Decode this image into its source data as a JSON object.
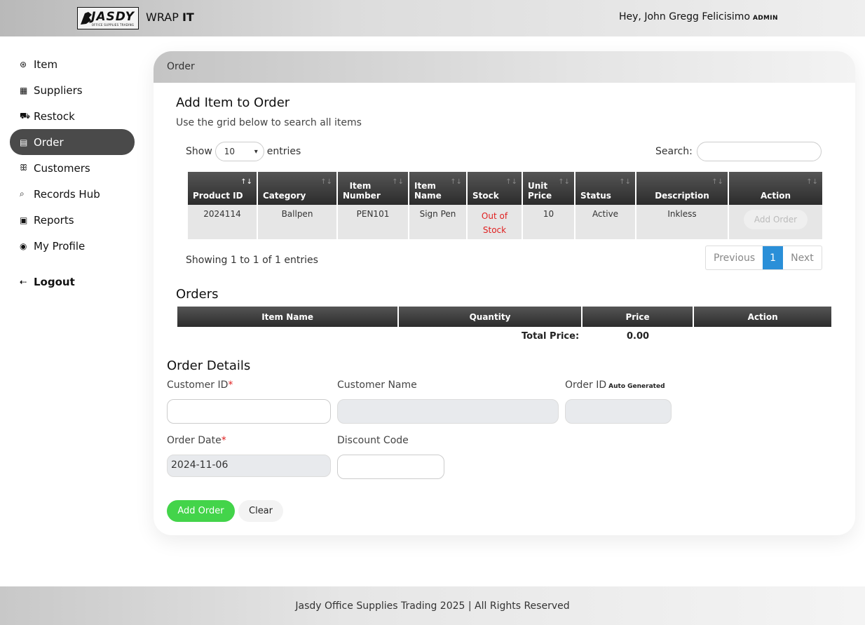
{
  "header": {
    "logo_text": "JASDY",
    "logo_subtext": "OFFICE SUPPLIES TRADING",
    "brand_prefix": "WRAP ",
    "brand_bold": "IT",
    "greeting": "Hey, John Gregg Felicisimo",
    "role": "ADMIN"
  },
  "sidebar": {
    "items": [
      {
        "label": "Item",
        "icon": "box-icon",
        "glyph": "⊛"
      },
      {
        "label": "Suppliers",
        "icon": "store-icon",
        "glyph": "▦"
      },
      {
        "label": "Restock",
        "icon": "cart-icon",
        "glyph": "⛟"
      },
      {
        "label": "Order",
        "icon": "receipt-icon",
        "glyph": "▤"
      },
      {
        "label": "Customers",
        "icon": "users-icon",
        "glyph": "ꕥ"
      },
      {
        "label": "Records Hub",
        "icon": "search-doc-icon",
        "glyph": "⌕"
      },
      {
        "label": "Reports",
        "icon": "clipboard-icon",
        "glyph": "▣"
      },
      {
        "label": "My Profile",
        "icon": "user-circle-icon",
        "glyph": "◉"
      }
    ],
    "logout": {
      "label": "Logout",
      "icon": "logout-icon",
      "glyph": "⇠"
    },
    "active_index": 3
  },
  "card": {
    "breadcrumb": "Order",
    "add_title": "Add Item to Order",
    "add_subtitle": "Use the grid below to search all items",
    "show_label": "Show",
    "entries_value": "10",
    "entries_label": "entries",
    "search_label": "Search:",
    "search_value": "",
    "columns": [
      "Product ID",
      "Category",
      "Item Number",
      "Item Name",
      "Stock",
      "Unit Price",
      "Status",
      "Description",
      "Action"
    ],
    "rows": [
      {
        "product_id": "2024114",
        "category": "Ballpen",
        "item_number": "PEN101",
        "item_name": "Sign Pen",
        "stock": "Out of Stock",
        "unit_price": "10",
        "status": "Active",
        "description": "Inkless",
        "action": "Add Order"
      }
    ],
    "showing": "Showing 1 to 1 of 1 entries",
    "pager": {
      "previous": "Previous",
      "current": "1",
      "next": "Next"
    },
    "orders_title": "Orders",
    "order_columns": [
      "Item Name",
      "Quantity",
      "Price",
      "Action"
    ],
    "total_label": "Total Price:",
    "total_value": "0.00"
  },
  "details": {
    "title": "Order Details",
    "customer_id_label": "Customer ID",
    "customer_id_value": "",
    "customer_name_label": "Customer Name",
    "customer_name_value": "",
    "order_id_label": "Order ID",
    "order_id_tag": "Auto Generated",
    "order_id_value": "",
    "order_date_label": "Order Date",
    "order_date_value": "2024-11-06",
    "discount_label": "Discount Code",
    "discount_value": "",
    "required_mark": "*",
    "add_button": "Add Order",
    "clear_button": "Clear"
  },
  "footer": {
    "text": "Jasdy Office Supplies Trading 2025 | All Rights Reserved"
  }
}
